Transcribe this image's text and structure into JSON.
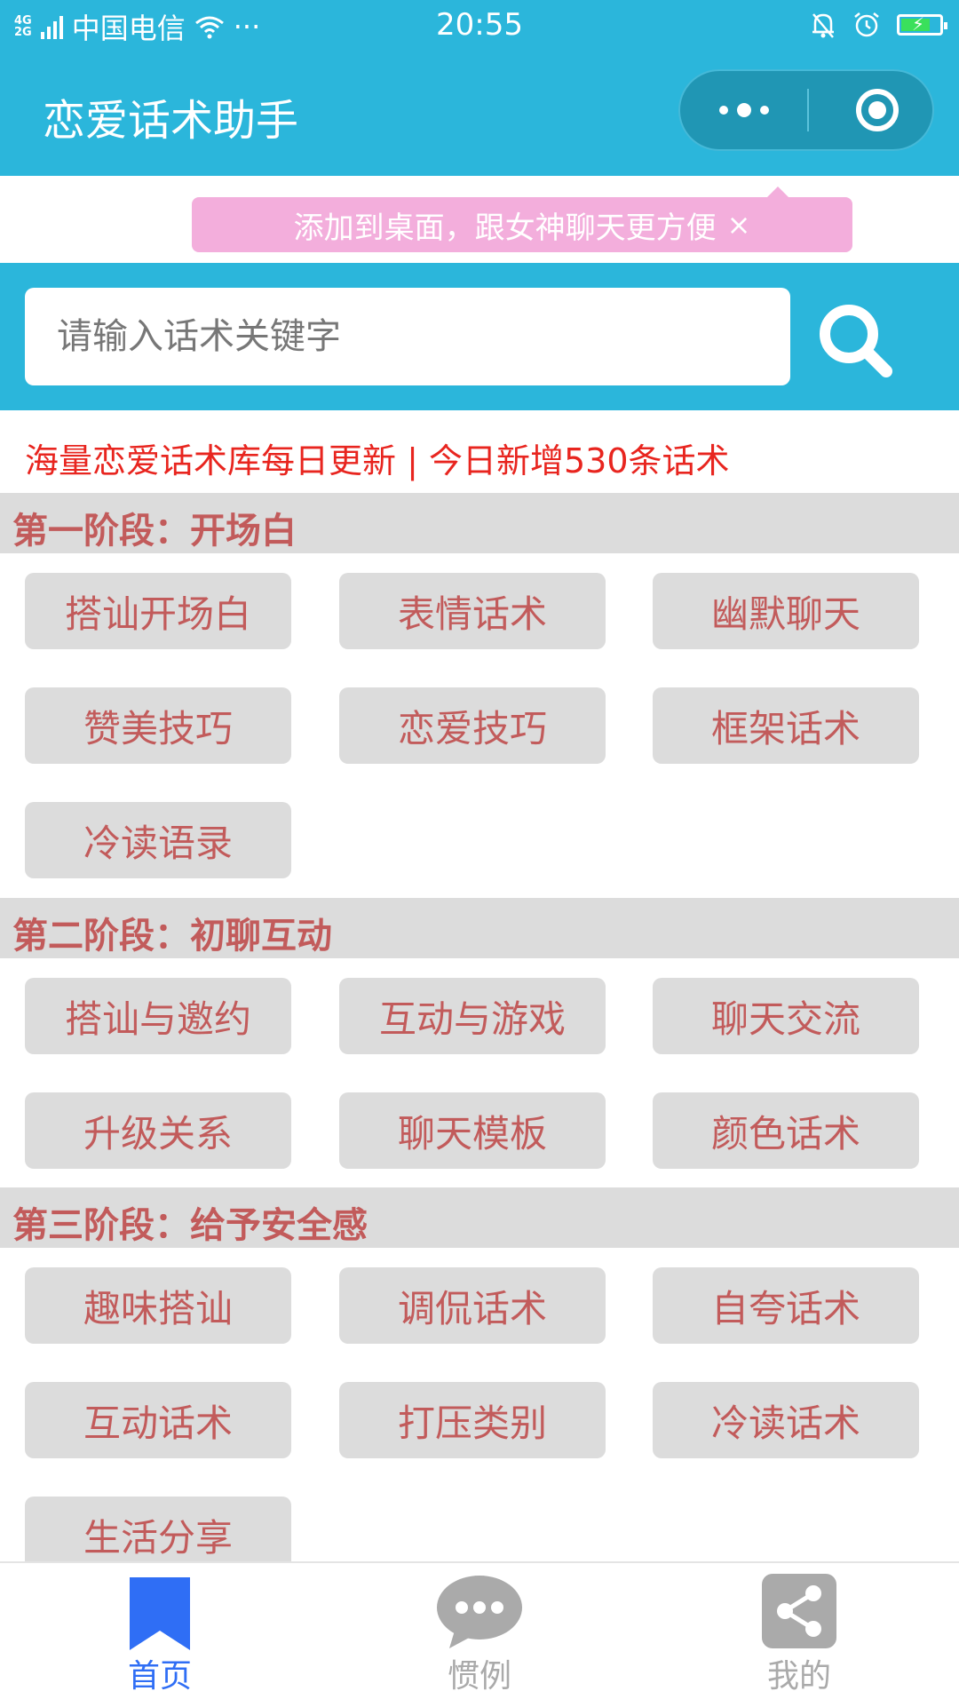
{
  "status": {
    "network_top": "4G",
    "network_bottom": "2G",
    "carrier": "中国电信",
    "more": "···",
    "time": "20:55"
  },
  "header": {
    "title": "恋爱话术助手"
  },
  "tip": {
    "text": "添加到桌面，跟女神聊天更方便",
    "close": "×"
  },
  "search": {
    "placeholder": "请输入话术关键字"
  },
  "notice": "海量恋爱话术库每日更新 | 今日新增530条话术",
  "sections": [
    {
      "title": "第一阶段：开场白",
      "items": [
        "搭讪开场白",
        "表情话术",
        "幽默聊天",
        "赞美技巧",
        "恋爱技巧",
        "框架话术",
        "冷读语录"
      ]
    },
    {
      "title": "第二阶段：初聊互动",
      "items": [
        "搭讪与邀约",
        "互动与游戏",
        "聊天交流",
        "升级关系",
        "聊天模板",
        "颜色话术"
      ]
    },
    {
      "title": "第三阶段：给予安全感",
      "items": [
        "趣味搭讪",
        "调侃话术",
        "自夸话术",
        "互动话术",
        "打压类别",
        "冷读话术",
        "生活分享"
      ]
    }
  ],
  "tabbar": {
    "tabs": [
      {
        "label": "首页",
        "active": true
      },
      {
        "label": "惯例",
        "active": false
      },
      {
        "label": "我的",
        "active": false
      }
    ],
    "active_color": "#2f6ef5",
    "inactive_color": "#aaaaaa"
  },
  "colors": {
    "primary": "#2bb6db",
    "tag_bg": "#dcdcdc",
    "tag_text": "#c25b5b",
    "notice": "#e8251f",
    "tip_bg": "#f3aedc"
  }
}
